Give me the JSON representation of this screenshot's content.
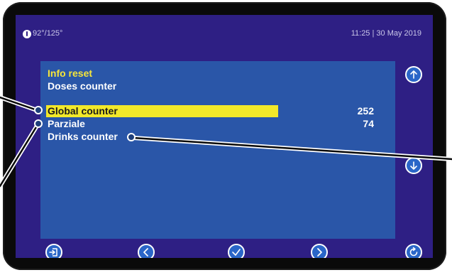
{
  "status": {
    "temperature": "92°/125°",
    "datetime": "11:25 | 30 May 2019"
  },
  "screen": {
    "title": "Info reset",
    "subtitle": "Doses counter",
    "rows": [
      {
        "label": "Global counter",
        "value": "252",
        "selected": true
      },
      {
        "label": "Parziale",
        "value": "74",
        "selected": false
      },
      {
        "label": "Drinks counter",
        "value": "",
        "selected": false
      }
    ]
  },
  "icons": {
    "temperature": "thermometer-icon",
    "up": "arrow-up-icon",
    "down": "arrow-down-icon",
    "exit": "exit-icon",
    "left": "chevron-left-icon",
    "confirm": "check-icon",
    "right": "chevron-right-icon",
    "reset": "refresh-icon"
  },
  "colors": {
    "screen_bg": "#2e1f84",
    "panel_bg": "#2a56a8",
    "title_accent": "#f6e63a",
    "selection": "#f2e829",
    "button_fill": "#2a66c8"
  }
}
